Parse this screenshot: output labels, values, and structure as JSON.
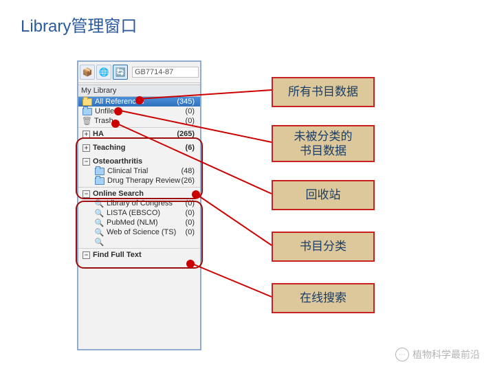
{
  "title": "Library管理窗口",
  "toolbar": {
    "style": "GB7714-87"
  },
  "panel": {
    "header": "My Library",
    "allRef": {
      "label": "All References",
      "count": "(345)",
      "icon": "folder"
    },
    "unfiled": {
      "label": "Unfiled",
      "count": "(0)"
    },
    "trash": {
      "label": "Trash",
      "count": "(0)"
    },
    "groups": [
      {
        "label": "HA",
        "count": "(265)",
        "expand": "+"
      },
      {
        "label": "Teaching",
        "count": "(6)",
        "expand": "+"
      },
      {
        "label": "Osteoarthritis",
        "count": "",
        "expand": "−",
        "children": [
          {
            "label": "Clinical Trial",
            "count": "(48)"
          },
          {
            "label": "Drug Therapy Review",
            "count": "(26)"
          }
        ]
      }
    ],
    "online": {
      "label": "Online Search",
      "expand": "−",
      "items": [
        {
          "label": "Library of Congress",
          "count": "(0)"
        },
        {
          "label": "LISTA (EBSCO)",
          "count": "(0)"
        },
        {
          "label": "PubMed (NLM)",
          "count": "(0)"
        },
        {
          "label": "Web of Science (TS)",
          "count": "(0)"
        }
      ]
    },
    "findFullText": {
      "label": "Find Full Text",
      "expand": "−"
    }
  },
  "callouts": {
    "c1": "所有书目数据",
    "c2": "未被分类的\n书目数据",
    "c3": "回收站",
    "c4": "书目分类",
    "c5": "在线搜索"
  },
  "watermark": "植物科学最前沿"
}
